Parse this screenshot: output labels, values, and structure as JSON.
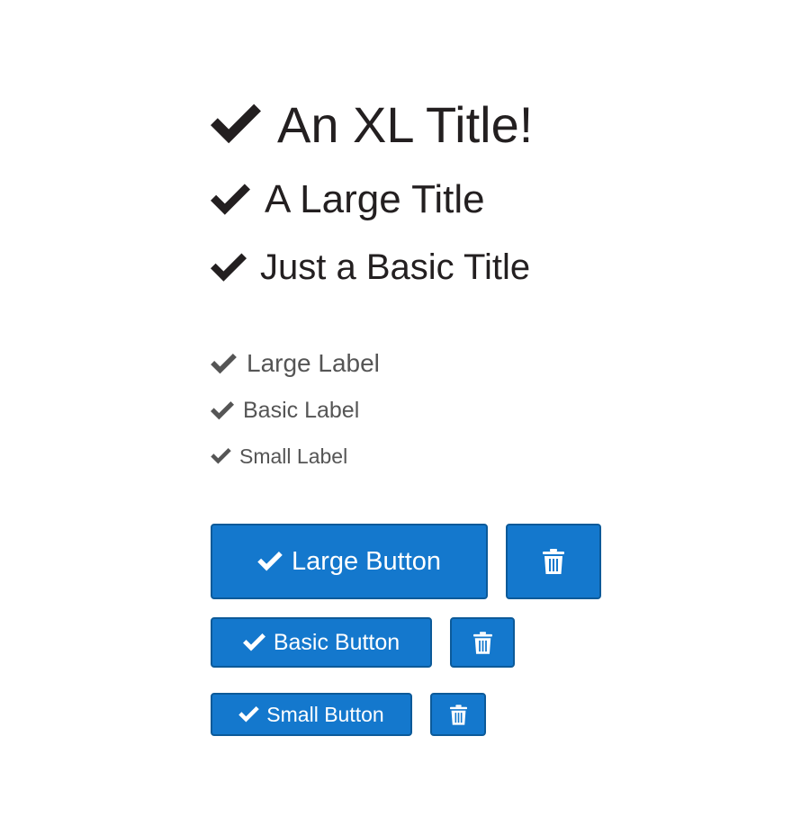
{
  "titles": {
    "xl": "An XL Title!",
    "large": "A Large Title",
    "basic": "Just a Basic Title"
  },
  "labels": {
    "large": "Large Label",
    "basic": "Basic Label",
    "small": "Small Label"
  },
  "buttons": {
    "large": "Large Button",
    "basic": "Basic Button",
    "small": "Small Button"
  },
  "icons": {
    "check": "check-icon",
    "trash": "trash-icon"
  },
  "colors": {
    "title_text": "#231f20",
    "label_text": "#555555",
    "button_bg": "#1478cd",
    "button_border": "#0c5a99",
    "button_text": "#ffffff"
  }
}
